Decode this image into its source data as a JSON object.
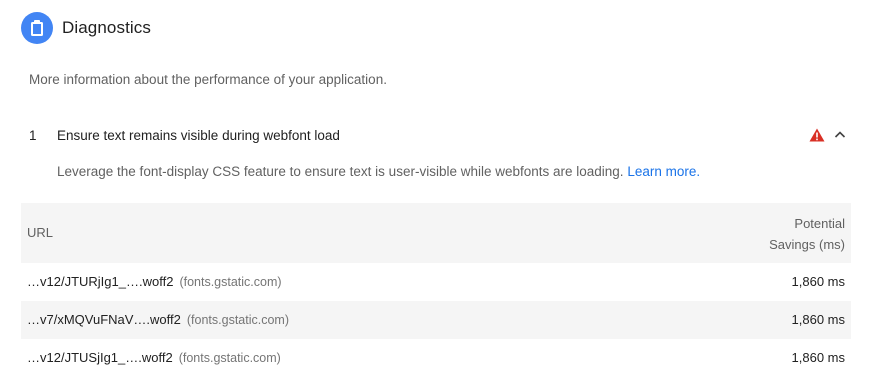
{
  "section": {
    "title": "Diagnostics",
    "description": "More information about the performance of your application.",
    "icon": "clipboard-icon",
    "accent": "#4285f4"
  },
  "audit": {
    "index": "1",
    "title": "Ensure text remains visible during webfont load",
    "status_icon": "warning-triangle-icon",
    "status_color": "#d93025",
    "description": "Leverage the font-display CSS feature to ensure text is user-visible while webfonts are loading.",
    "learn_more": "Learn more."
  },
  "table": {
    "headers": {
      "url": "URL",
      "savings_line1": "Potential",
      "savings_line2": "Savings (ms)"
    },
    "rows": [
      {
        "url": "…v12/JTURjIg1_….woff2",
        "host": "(fonts.gstatic.com)",
        "savings": "1,860 ms"
      },
      {
        "url": "…v7/xMQVuFNaV….woff2",
        "host": "(fonts.gstatic.com)",
        "savings": "1,860 ms"
      },
      {
        "url": "…v12/JTUSjIg1_….woff2",
        "host": "(fonts.gstatic.com)",
        "savings": "1,860 ms"
      }
    ]
  }
}
